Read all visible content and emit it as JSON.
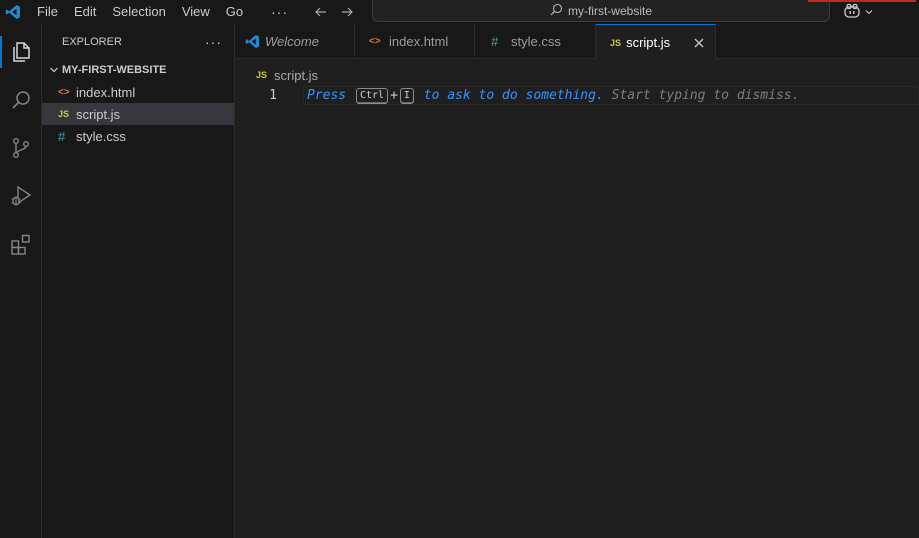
{
  "menu": [
    "File",
    "Edit",
    "Selection",
    "View",
    "Go"
  ],
  "menu_more": "···",
  "command_center": {
    "text": "my-first-website"
  },
  "colors": {
    "accent": "#0078d4",
    "hint_blue": "#3794ff",
    "js": "#cbcb41",
    "css": "#519aba",
    "html": "#e37933"
  },
  "sidebar": {
    "title": "EXPLORER",
    "more": "···",
    "folder": "MY-FIRST-WEBSITE",
    "files": [
      {
        "icon": "<>",
        "name": "index.html"
      },
      {
        "icon": "JS",
        "name": "script.js"
      },
      {
        "icon": "#",
        "name": "style.css"
      }
    ]
  },
  "tabs": [
    {
      "label": "Welcome"
    },
    {
      "icon": "<>",
      "label": "index.html"
    },
    {
      "icon": "#",
      "label": "style.css"
    },
    {
      "icon": "JS",
      "label": "script.js"
    }
  ],
  "breadcrumb": {
    "icon": "JS",
    "file": "script.js"
  },
  "editor": {
    "line_number": "1",
    "hint": {
      "press": "Press",
      "key1": "Ctrl",
      "plus": "+",
      "key2": "I",
      "action": "to ask to do something.",
      "dismiss": "Start typing to dismiss."
    }
  }
}
